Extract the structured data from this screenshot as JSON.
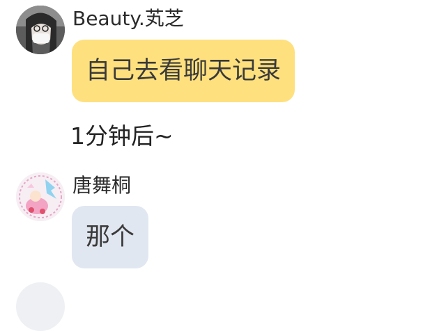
{
  "messages": [
    {
      "sender": "Beauty.芄芝",
      "text": "自己去看聊天记录",
      "bubble_color": "#ffe07e"
    },
    {
      "sender": "唐舞桐",
      "text": "那个",
      "bubble_color": "#e1e7f1"
    }
  ],
  "system_text": "1分钟后~",
  "colors": {
    "background": "#ffffff"
  }
}
